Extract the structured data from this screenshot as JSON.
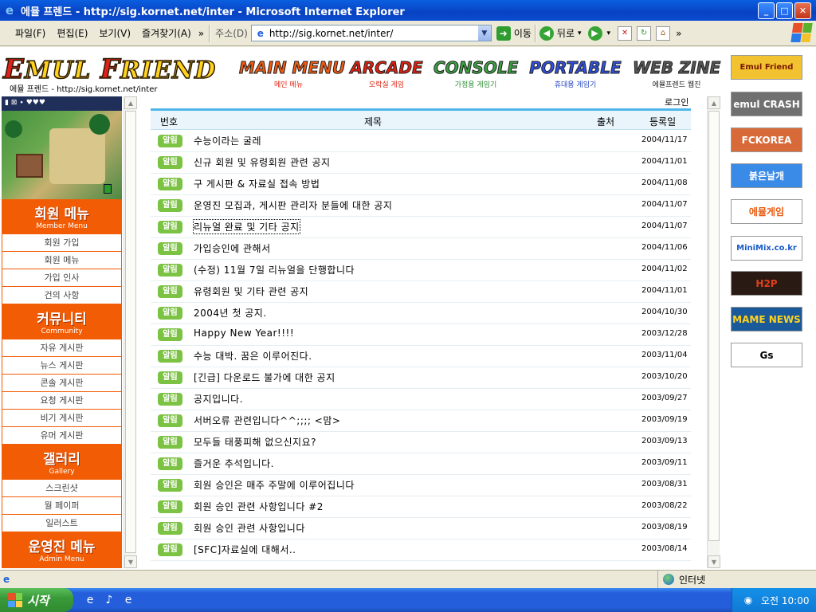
{
  "window": {
    "title": "에뮬 프렌드 - http://sig.kornet.net/inter - Microsoft Internet Explorer",
    "min": "_",
    "max": "□",
    "close": "✕"
  },
  "toolbar": {
    "menus": [
      "파일(F)",
      "편집(E)",
      "보기(V)",
      "즐겨찾기(A)"
    ],
    "overflow": "»",
    "address_label": "주소(D)",
    "url": "http://sig.kornet.net/inter/",
    "go_label": "이동",
    "back_label": "뒤로"
  },
  "site": {
    "logo_e": "E",
    "logo_mul": "MUL ",
    "logo_f": "F",
    "logo_riend": "RIEND",
    "subtitle": "에뮬 프렌드 - http://sig.kornet.net/inter",
    "nav": [
      {
        "big": "MAIN MENU",
        "small": "메인 메뉴",
        "color": "#f05a10"
      },
      {
        "big": "ARCADE",
        "small": "오락실 게임",
        "color": "#e02010"
      },
      {
        "big": "CONSOLE",
        "small": "가정용 게임기",
        "color": "#3aa040"
      },
      {
        "big": "PORTABLE",
        "small": "휴대용 게임기",
        "color": "#3050e0"
      },
      {
        "big": "WEB ZINE",
        "small": "에뮬프렌드 웹진",
        "color": "#555555"
      }
    ]
  },
  "sidebar": {
    "member": {
      "title": "회원 메뉴",
      "sub": "Member Menu",
      "items": [
        "회원 가입",
        "회원 메뉴",
        "가입 인사",
        "건의 사항"
      ]
    },
    "community": {
      "title": "커뮤니티",
      "sub": "Community",
      "items": [
        "자유 게시판",
        "뉴스 게시판",
        "콘솔 게시판",
        "요청 게시판",
        "비기 게시판",
        "유머 게시판"
      ]
    },
    "gallery": {
      "title": "갤러리",
      "sub": "Gallery",
      "items": [
        "스크린샷",
        "월 페이퍼",
        "일러스트"
      ]
    },
    "admin": {
      "title": "운영진 메뉴",
      "sub": "Admin Menu"
    }
  },
  "board": {
    "login": "로그인",
    "headers": {
      "num": "번호",
      "title": "제목",
      "author": "출처",
      "date": "등록일"
    },
    "badge": "알림",
    "rows": [
      {
        "title": "수능이라는 굴레",
        "date": "2004/11/17"
      },
      {
        "title": "신규 회원 및 유령회원 관련 공지",
        "date": "2004/11/01"
      },
      {
        "title": "구 게시판 & 자료실 접속 방법",
        "date": "2004/11/08"
      },
      {
        "title": "운영진 모집과, 게시판 관리자 분들에 대한 공지",
        "date": "2004/11/07"
      },
      {
        "title": "리뉴얼 완료 및 기타 공지",
        "date": "2004/11/07"
      },
      {
        "title": "가입승인에 관해서",
        "date": "2004/11/06"
      },
      {
        "title": "(수정) 11월 7일 리뉴얼을 단행합니다",
        "date": "2004/11/02"
      },
      {
        "title": "유령회원 및 기타 관련 공지",
        "date": "2004/11/01"
      },
      {
        "title": "2004년 첫 공지.",
        "date": "2004/10/30"
      },
      {
        "title": "Happy New Year!!!!",
        "date": "2003/12/28"
      },
      {
        "title": "수능 대박. 꿈은 이루어진다.",
        "date": "2003/11/04"
      },
      {
        "title": "[긴급] 다운로드 불가에 대한 공지",
        "date": "2003/10/20"
      },
      {
        "title": "공지입니다.",
        "date": "2003/09/27"
      },
      {
        "title": "서버오류 관련입니다^^;;;; <맘>",
        "date": "2003/09/19"
      },
      {
        "title": "모두들 태풍피해 없으신지요?",
        "date": "2003/09/13"
      },
      {
        "title": "즐거운 추석입니다.",
        "date": "2003/09/11"
      },
      {
        "title": "회원 승인은 매주 주말에 이루어집니다",
        "date": "2003/08/31"
      },
      {
        "title": "회원 승인 관련 사항입니다 #2",
        "date": "2003/08/22"
      },
      {
        "title": "회원 승인 관련 사항입니다",
        "date": "2003/08/19"
      },
      {
        "title": "[SFC]자료실에 대해서..",
        "date": "2003/08/14"
      }
    ]
  },
  "banners": [
    {
      "text": "Emul Friend",
      "bg": "#f2c230",
      "fg": "#7a1a00"
    },
    {
      "text": "emul CRASH",
      "bg": "#707070",
      "fg": "#ffffff"
    },
    {
      "text": "FCKOREA",
      "bg": "#d86a3a",
      "fg": "#ffffff"
    },
    {
      "text": "붉은날개",
      "bg": "#3a8ae8",
      "fg": "#ffffff"
    },
    {
      "text": "에뮬게임",
      "bg": "#ffffff",
      "fg": "#e85a10"
    },
    {
      "text": "MiniMix.co.kr",
      "bg": "#ffffff",
      "fg": "#1a5ac8"
    },
    {
      "text": "H2P",
      "bg": "#2a1a14",
      "fg": "#e0401a"
    },
    {
      "text": "MAME NEWS",
      "bg": "#1a5a9a",
      "fg": "#ffd21f"
    },
    {
      "text": "Gs",
      "bg": "#ffffff",
      "fg": "#000000"
    }
  ],
  "status": {
    "zone": "인터넷"
  },
  "taskbar": {
    "start": "시작",
    "clock": "오전 10:00"
  }
}
